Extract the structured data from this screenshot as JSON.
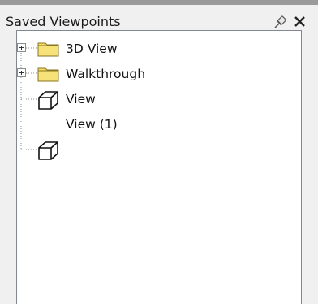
{
  "panel": {
    "title": "Saved Viewpoints",
    "pin_icon": "pin-icon",
    "close_icon": "close-icon"
  },
  "tree": {
    "items": [
      {
        "label": "3D View",
        "icon": "folder-icon",
        "expandable": true
      },
      {
        "label": "Walkthrough",
        "icon": "folder-icon",
        "expandable": true
      },
      {
        "label": "View",
        "icon": "viewpoint-cube-icon",
        "expandable": false
      },
      {
        "label": "View (1)",
        "icon": "viewpoint-cube-icon",
        "expandable": false
      }
    ]
  },
  "colors": {
    "panel_background": "#f0f0f0",
    "tree_background": "#ffffff",
    "tree_border": "#828790",
    "folder_fill": "#f5dc6a",
    "folder_outline": "#8a7420",
    "top_strip": "#9a9a9a"
  }
}
